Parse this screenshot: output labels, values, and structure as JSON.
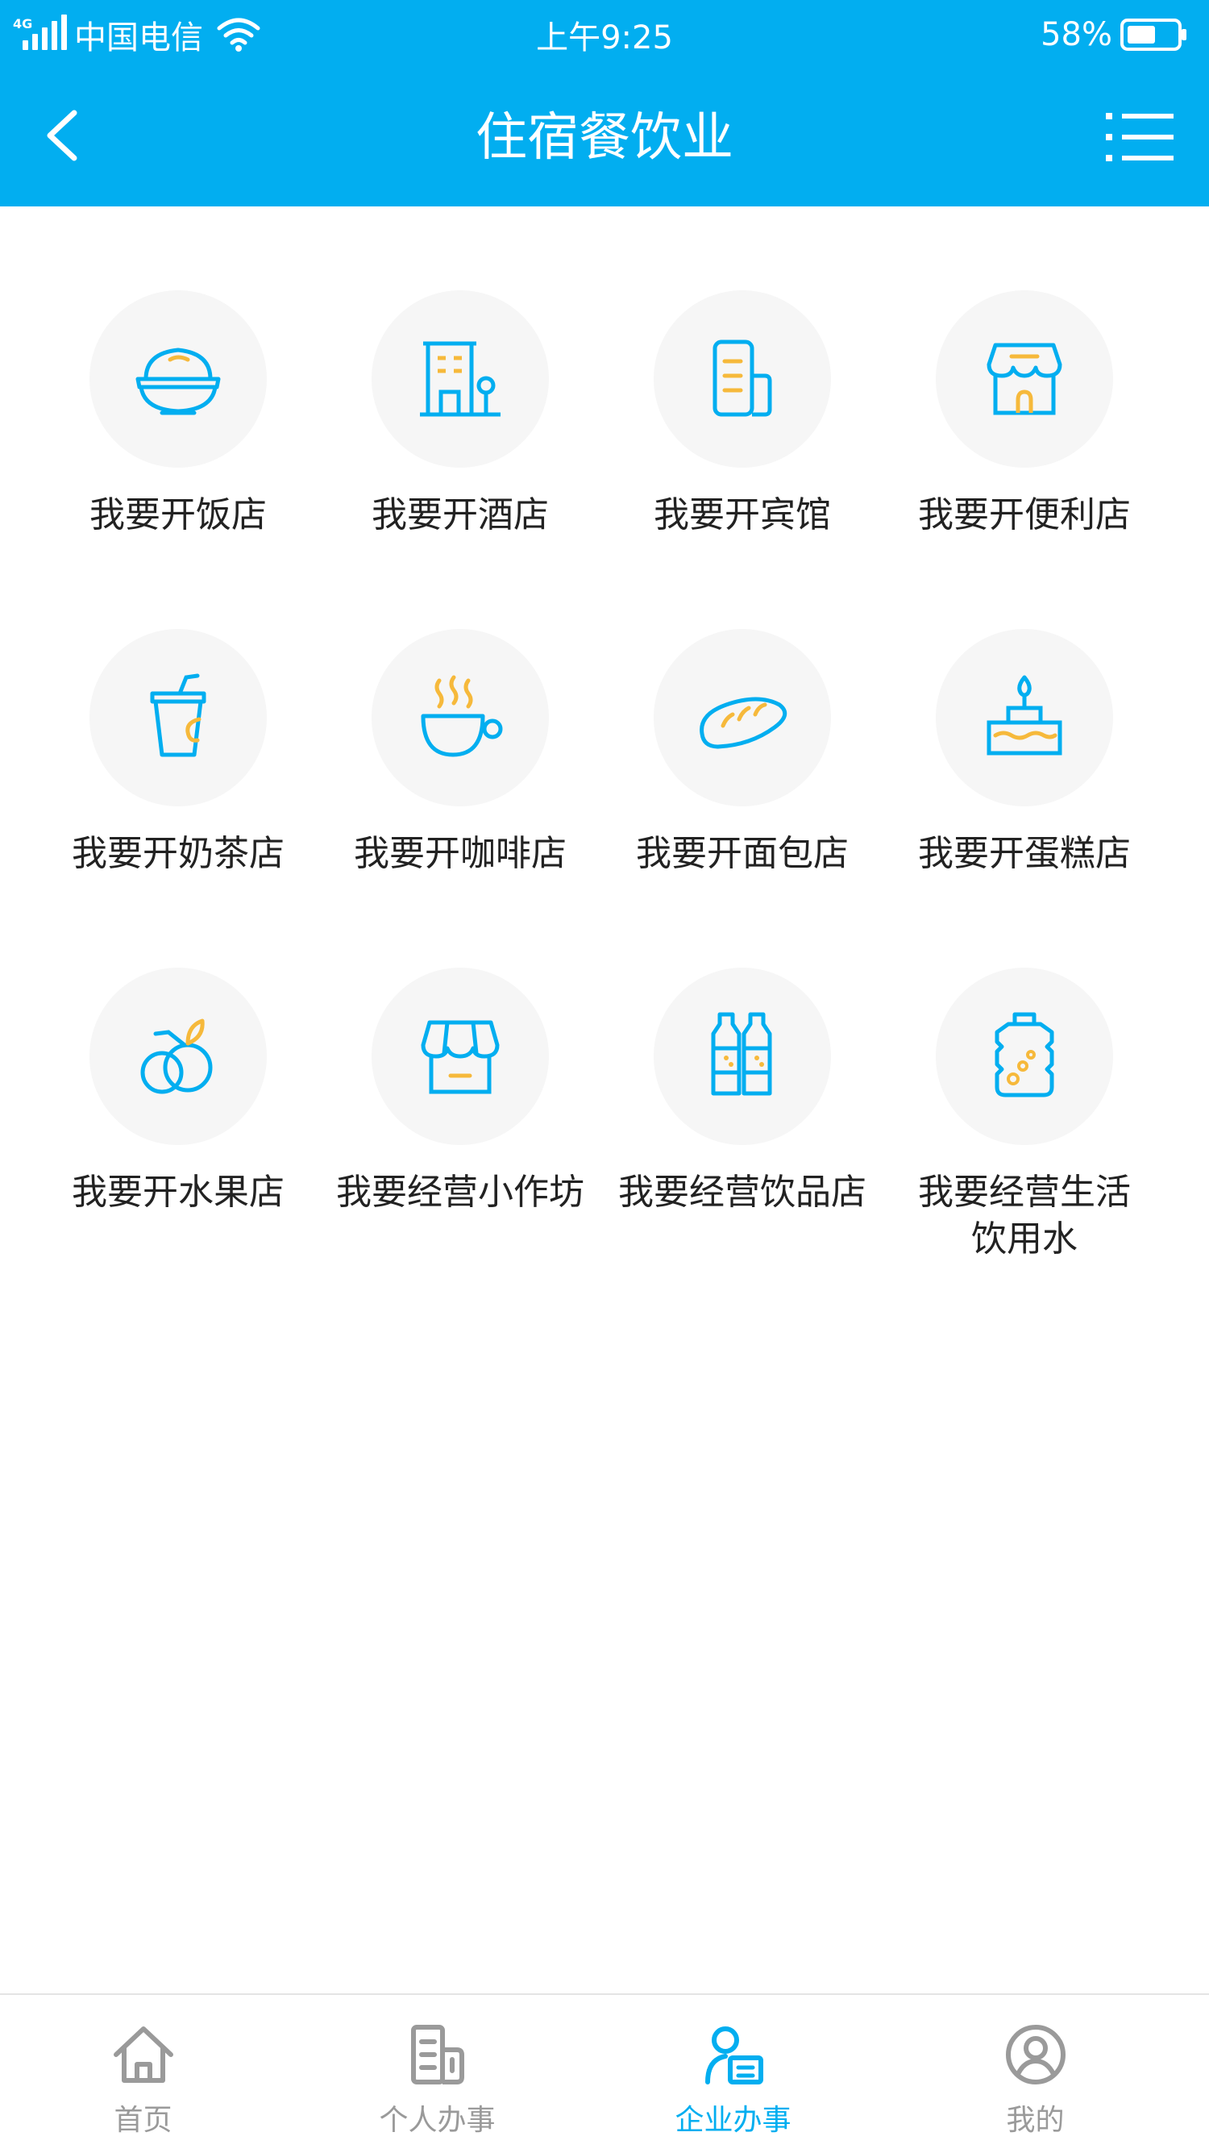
{
  "status_bar": {
    "network": "4G",
    "carrier": "中国电信",
    "time": "上午9:25",
    "battery_percent": "58%",
    "battery_level": 0.58
  },
  "header": {
    "title": "住宿餐饮业",
    "back_icon": "chevron-left-icon",
    "menu_icon": "list-menu-icon"
  },
  "colors": {
    "primary": "#02aef0",
    "accent": "#f6b93b",
    "icon_bg": "#f6f6f6",
    "text": "#222222",
    "tab_inactive": "#9a9a9a"
  },
  "services": [
    {
      "label": "我要开饭店",
      "icon": "rice-bowl-icon"
    },
    {
      "label": "我要开酒店",
      "icon": "hotel-building-icon"
    },
    {
      "label": "我要开宾馆",
      "icon": "guesthouse-icon"
    },
    {
      "label": "我要开便利店",
      "icon": "store-front-icon"
    },
    {
      "label": "我要开奶茶店",
      "icon": "milk-tea-cup-icon"
    },
    {
      "label": "我要开咖啡店",
      "icon": "coffee-cup-icon"
    },
    {
      "label": "我要开面包店",
      "icon": "bread-icon"
    },
    {
      "label": "我要开蛋糕店",
      "icon": "cake-icon"
    },
    {
      "label": "我要开水果店",
      "icon": "fruit-icon"
    },
    {
      "label": "我要经营小作坊",
      "icon": "workshop-shop-icon"
    },
    {
      "label": "我要经营饮品店",
      "icon": "beverage-bottles-icon"
    },
    {
      "label": "我要经营生活饮用水",
      "icon": "water-jug-icon"
    }
  ],
  "tabs": [
    {
      "label": "首页",
      "icon": "home-icon",
      "active": false
    },
    {
      "label": "个人办事",
      "icon": "personal-affairs-icon",
      "active": false
    },
    {
      "label": "企业办事",
      "icon": "enterprise-affairs-icon",
      "active": true
    },
    {
      "label": "我的",
      "icon": "user-profile-icon",
      "active": false
    }
  ]
}
